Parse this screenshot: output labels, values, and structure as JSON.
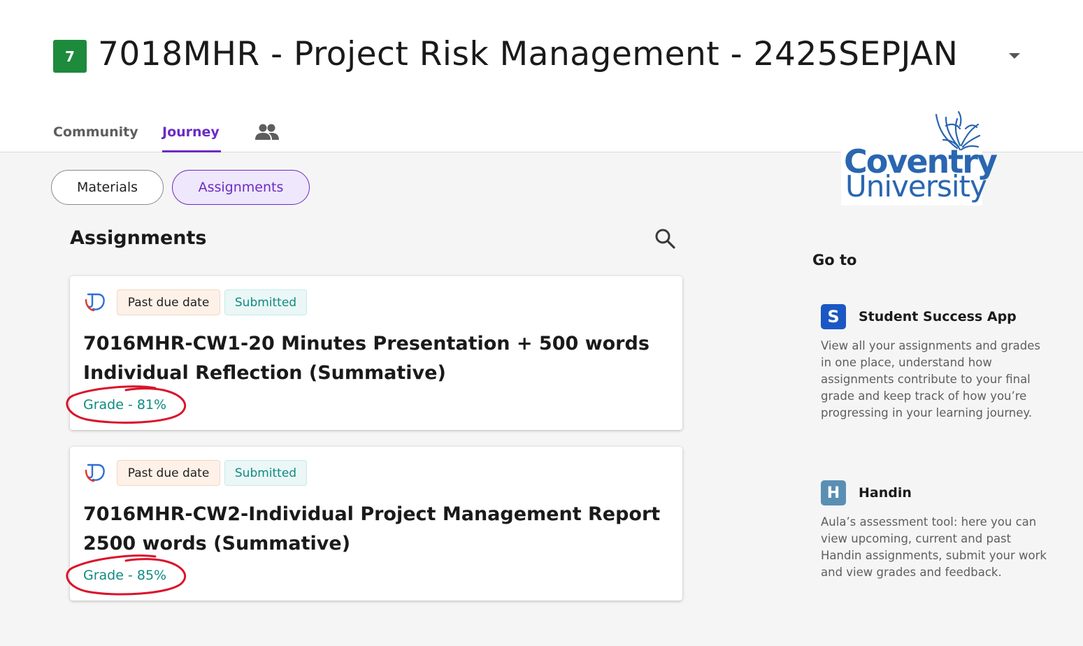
{
  "course": {
    "badge": "7",
    "title": "7018MHR - Project Risk Management - 2425SEPJAN"
  },
  "tabs": {
    "community": "Community",
    "journey": "Journey",
    "people_icon": "people-icon"
  },
  "logo": {
    "line1": "Coventry",
    "line2": "University"
  },
  "filters": {
    "materials": "Materials",
    "assignments": "Assignments"
  },
  "section": {
    "title": "Assignments",
    "search_icon": "search-icon"
  },
  "assignments": [
    {
      "icon": "turnitin-icon",
      "badge_due": "Past due date",
      "badge_status": "Submitted",
      "title": "7016MHR-CW1-20 Minutes Presentation + 500 words Individual Reflection (Summative)",
      "grade": "Grade - 81%",
      "grade_value": 81
    },
    {
      "icon": "turnitin-icon",
      "badge_due": "Past due date",
      "badge_status": "Submitted",
      "title": "7016MHR-CW2-Individual Project Management Report 2500 words (Summative)",
      "grade": "Grade - 85%",
      "grade_value": 85
    }
  ],
  "goto": {
    "title": "Go to",
    "apps": [
      {
        "icon_letter": "S",
        "name": "Student Success App",
        "description": "View all your assignments and grades in one place, understand how assignments contribute to your final grade and keep track of how you’re progressing in your learning journey."
      },
      {
        "icon_letter": "H",
        "name": "Handin",
        "description": "Aula’s assessment tool: here you can view upcoming, current and past Handin assignments, submit your work and view grades and feedback."
      }
    ]
  },
  "colors": {
    "accent": "#6b2bc4",
    "course_badge": "#1e8a3c",
    "grade_text": "#0f8a80",
    "annotation": "#d9142b"
  }
}
